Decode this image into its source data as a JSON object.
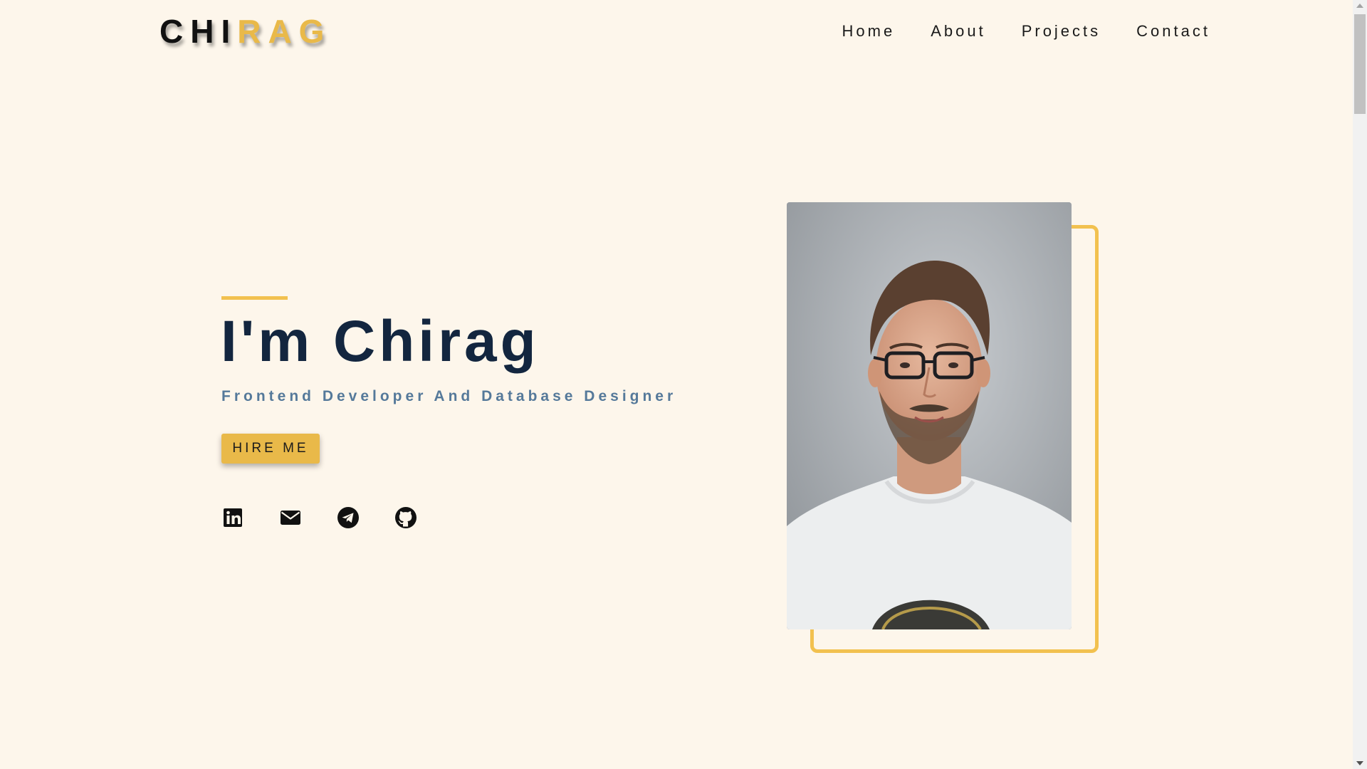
{
  "header": {
    "logo": {
      "part1": "CHI",
      "part2": "RAG"
    },
    "nav": [
      {
        "label": "Home"
      },
      {
        "label": "About"
      },
      {
        "label": "Projects"
      },
      {
        "label": "Contact"
      }
    ]
  },
  "hero": {
    "title": "I'm Chirag",
    "subtitle": "Frontend Developer And Database Designer",
    "cta_label": "HIRE ME",
    "socials": [
      {
        "icon": "linkedin-icon"
      },
      {
        "icon": "email-icon"
      },
      {
        "icon": "telegram-icon"
      },
      {
        "icon": "github-icon"
      }
    ]
  },
  "photo": {
    "subject": "portrait-photo"
  },
  "colors": {
    "background": "#fdf6eb",
    "accent": "#e9b949",
    "frame": "#f2c14f",
    "title": "#13263f",
    "subtitle": "#55799a"
  }
}
